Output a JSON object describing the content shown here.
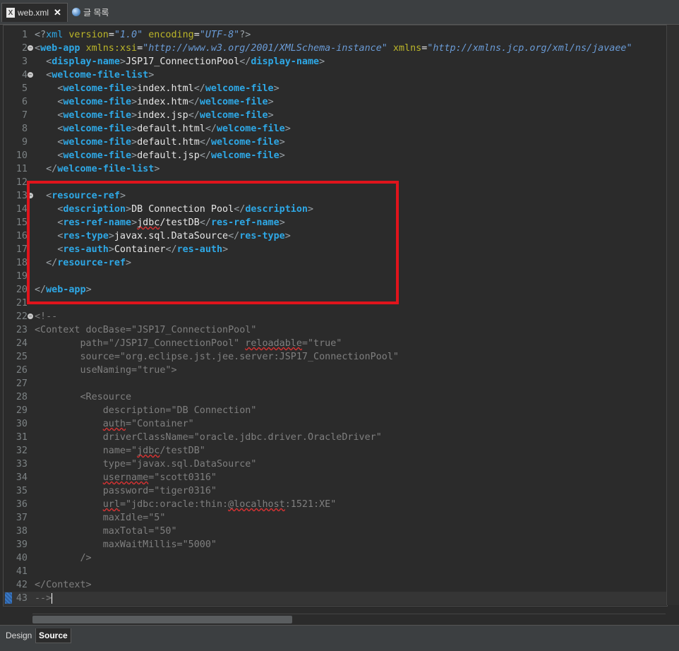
{
  "tabs": [
    {
      "label": "web.xml",
      "icon": "xml-file-icon",
      "active": true
    },
    {
      "label": "글 목록",
      "icon": "globe-icon",
      "active": false
    }
  ],
  "editor": {
    "lines": [
      {
        "n": "1",
        "html": "<span class=\"bracket\">&lt;?</span><span class=\"pi\">xml</span> <span class=\"attr\">version</span><span class=\"content\">=</span><span class=\"val\">\"1.0\"</span> <span class=\"attr\">encoding</span><span class=\"content\">=</span><span class=\"val\">\"UTF-8\"</span><span class=\"bracket\">?&gt;</span>"
      },
      {
        "n": "2",
        "fold": true,
        "html": "<span class=\"bracket\">&lt;</span><span class=\"tag\">web-app</span> <span class=\"attr\">xmlns:xsi</span><span class=\"content\">=</span><span class=\"val\">\"http://www.w3.org/2001/XMLSchema-instance\"</span> <span class=\"attr\">xmlns</span><span class=\"content\">=</span><span class=\"val\">\"http://xmlns.jcp.org/xml/ns/javaee\"</span>"
      },
      {
        "n": "3",
        "html": "  <span class=\"bracket\">&lt;</span><span class=\"tag\">display-name</span><span class=\"bracket\">&gt;</span><span class=\"content\">JSP17_ConnectionPool</span><span class=\"bracket\">&lt;/</span><span class=\"tag\">display-name</span><span class=\"bracket\">&gt;</span>"
      },
      {
        "n": "4",
        "fold": true,
        "html": "  <span class=\"bracket\">&lt;</span><span class=\"tag\">welcome-file-list</span><span class=\"bracket\">&gt;</span>"
      },
      {
        "n": "5",
        "html": "    <span class=\"bracket\">&lt;</span><span class=\"tag\">welcome-file</span><span class=\"bracket\">&gt;</span><span class=\"content\">index.html</span><span class=\"bracket\">&lt;/</span><span class=\"tag\">welcome-file</span><span class=\"bracket\">&gt;</span>"
      },
      {
        "n": "6",
        "html": "    <span class=\"bracket\">&lt;</span><span class=\"tag\">welcome-file</span><span class=\"bracket\">&gt;</span><span class=\"content\">index.htm</span><span class=\"bracket\">&lt;/</span><span class=\"tag\">welcome-file</span><span class=\"bracket\">&gt;</span>"
      },
      {
        "n": "7",
        "html": "    <span class=\"bracket\">&lt;</span><span class=\"tag\">welcome-file</span><span class=\"bracket\">&gt;</span><span class=\"content\">index.jsp</span><span class=\"bracket\">&lt;/</span><span class=\"tag\">welcome-file</span><span class=\"bracket\">&gt;</span>"
      },
      {
        "n": "8",
        "html": "    <span class=\"bracket\">&lt;</span><span class=\"tag\">welcome-file</span><span class=\"bracket\">&gt;</span><span class=\"content\">default.html</span><span class=\"bracket\">&lt;/</span><span class=\"tag\">welcome-file</span><span class=\"bracket\">&gt;</span>"
      },
      {
        "n": "9",
        "html": "    <span class=\"bracket\">&lt;</span><span class=\"tag\">welcome-file</span><span class=\"bracket\">&gt;</span><span class=\"content\">default.htm</span><span class=\"bracket\">&lt;/</span><span class=\"tag\">welcome-file</span><span class=\"bracket\">&gt;</span>"
      },
      {
        "n": "10",
        "html": "    <span class=\"bracket\">&lt;</span><span class=\"tag\">welcome-file</span><span class=\"bracket\">&gt;</span><span class=\"content\">default.jsp</span><span class=\"bracket\">&lt;/</span><span class=\"tag\">welcome-file</span><span class=\"bracket\">&gt;</span>"
      },
      {
        "n": "11",
        "html": "  <span class=\"bracket\">&lt;/</span><span class=\"tag\">welcome-file-list</span><span class=\"bracket\">&gt;</span>"
      },
      {
        "n": "12",
        "html": ""
      },
      {
        "n": "13",
        "fold": true,
        "html": "  <span class=\"bracket\">&lt;</span><span class=\"tag\">resource-ref</span><span class=\"bracket\">&gt;</span>"
      },
      {
        "n": "14",
        "html": "    <span class=\"bracket\">&lt;</span><span class=\"tag\">description</span><span class=\"bracket\">&gt;</span><span class=\"content\">DB Connection Pool</span><span class=\"bracket\">&lt;/</span><span class=\"tag\">description</span><span class=\"bracket\">&gt;</span>"
      },
      {
        "n": "15",
        "html": "    <span class=\"bracket\">&lt;</span><span class=\"tag\">res-ref-name</span><span class=\"bracket\">&gt;</span><span class=\"content\"><span class=\"squig\">jdbc</span>/testDB</span><span class=\"bracket\">&lt;/</span><span class=\"tag\">res-ref-name</span><span class=\"bracket\">&gt;</span>"
      },
      {
        "n": "16",
        "html": "    <span class=\"bracket\">&lt;</span><span class=\"tag\">res-type</span><span class=\"bracket\">&gt;</span><span class=\"content\">javax.sql.DataSource</span><span class=\"bracket\">&lt;/</span><span class=\"tag\">res-type</span><span class=\"bracket\">&gt;</span>"
      },
      {
        "n": "17",
        "html": "    <span class=\"bracket\">&lt;</span><span class=\"tag\">res-auth</span><span class=\"bracket\">&gt;</span><span class=\"content\">Container</span><span class=\"bracket\">&lt;/</span><span class=\"tag\">res-auth</span><span class=\"bracket\">&gt;</span>"
      },
      {
        "n": "18",
        "html": "  <span class=\"bracket\">&lt;/</span><span class=\"tag\">resource-ref</span><span class=\"bracket\">&gt;</span>"
      },
      {
        "n": "19",
        "html": ""
      },
      {
        "n": "20",
        "html": "<span class=\"bracket\">&lt;/</span><span class=\"tag\">web-app</span><span class=\"bracket\">&gt;</span>"
      },
      {
        "n": "21",
        "html": ""
      },
      {
        "n": "22",
        "fold": true,
        "html": "<span class=\"comment\">&lt;!--</span>"
      },
      {
        "n": "23",
        "html": "<span class=\"comment\">&lt;Context docBase=\"JSP17_ConnectionPool\"</span>"
      },
      {
        "n": "24",
        "html": "<span class=\"comment\">        path=\"/JSP17_ConnectionPool\" <span class=\"squig\">reloadable</span>=\"true\"</span>"
      },
      {
        "n": "25",
        "html": "<span class=\"comment\">        source=\"org.eclipse.jst.jee.server:JSP17_ConnectionPool\"</span>"
      },
      {
        "n": "26",
        "html": "<span class=\"comment\">        useNaming=\"true\"&gt;</span>"
      },
      {
        "n": "27",
        "html": ""
      },
      {
        "n": "28",
        "html": "<span class=\"comment\">        &lt;Resource</span>"
      },
      {
        "n": "29",
        "html": "<span class=\"comment\">            description=\"DB Connection\"</span>"
      },
      {
        "n": "30",
        "html": "<span class=\"comment\">            <span class=\"squig\">auth</span>=\"Container\"</span>"
      },
      {
        "n": "31",
        "html": "<span class=\"comment\">            driverClassName=\"oracle.jdbc.driver.OracleDriver\"</span>"
      },
      {
        "n": "32",
        "html": "<span class=\"comment\">            name=\"<span class=\"squig\">jdbc</span>/testDB\"</span>"
      },
      {
        "n": "33",
        "html": "<span class=\"comment\">            type=\"javax.sql.DataSource\"</span>"
      },
      {
        "n": "34",
        "html": "<span class=\"comment\">            <span class=\"squig\">username</span>=\"scott0316\"</span>"
      },
      {
        "n": "35",
        "html": "<span class=\"comment\">            password=\"tiger0316\"</span>"
      },
      {
        "n": "36",
        "html": "<span class=\"comment\">            <span class=\"squig\">url</span>=\"jdbc:oracle:thin:<span class=\"squig\">@localhost</span>:1521:XE\"</span>"
      },
      {
        "n": "37",
        "html": "<span class=\"comment\">            maxIdle=\"5\"</span>"
      },
      {
        "n": "38",
        "html": "<span class=\"comment\">            maxTotal=\"50\"</span>"
      },
      {
        "n": "39",
        "html": "<span class=\"comment\">            maxWaitMillis=\"5000\"</span>"
      },
      {
        "n": "40",
        "html": "<span class=\"comment\">        /&gt;</span>"
      },
      {
        "n": "41",
        "html": ""
      },
      {
        "n": "42",
        "html": "<span class=\"comment\">&lt;/Context&gt;</span>"
      },
      {
        "n": "43",
        "current": true,
        "bookmark": true,
        "html": "<span class=\"comment\">--&gt;</span><span class=\"caret\"></span>"
      }
    ]
  },
  "bottom_tabs": {
    "design": "Design",
    "source": "Source"
  },
  "colors": {
    "tag": "#2ea8e6",
    "attr": "#bbb529",
    "value": "#6a9bd6",
    "comment": "#7f7f7f",
    "highlight": "#e0141c"
  }
}
